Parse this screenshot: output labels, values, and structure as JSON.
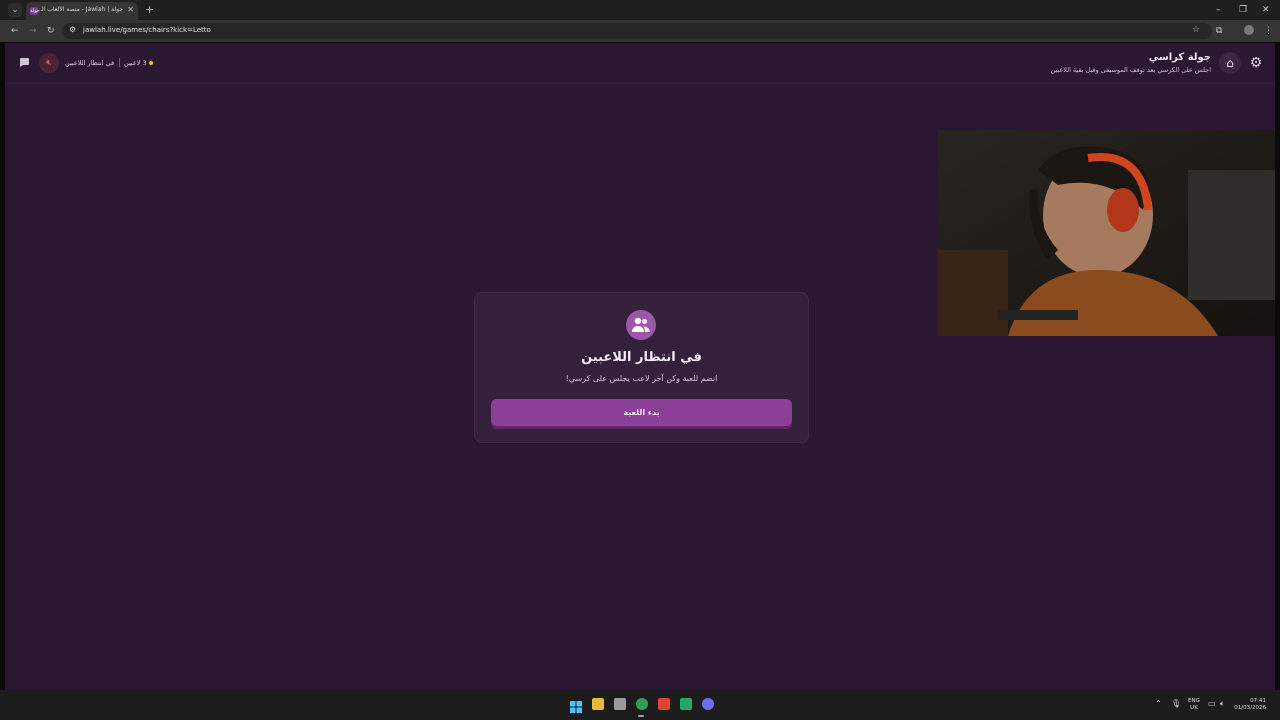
{
  "browser": {
    "tab_title": "جولة | Jawlah - منصة الألعاب الـ",
    "tab_favicon": "جولة",
    "url": "jawlah.live/games/chairs?kick=Letto"
  },
  "header": {
    "title": "جولة كراسي",
    "subtitle": "اجلس على الكرسي بعد توقف الموسيقى وقبل بقية اللاعبين",
    "status_text": "في انتظار اللاعبين",
    "players_count": "3 لاعبين"
  },
  "lobby": {
    "title": "في انتظار اللاعبين",
    "subtitle": "انضم للعبة وكن آخر لاعب يجلس على كرسي!",
    "start_button": "بدء اللعبة"
  },
  "taskbar": {
    "lang_line1": "ENG",
    "lang_line2": "UK",
    "time": "07:41",
    "date": "01/03/2026"
  },
  "colors": {
    "page_background": "#2a1732",
    "card_background": "#33213b",
    "accent": "#8b3f96",
    "icon_circle": "#9c58a8",
    "muted_red": "#e2507a",
    "status_dot": "#f0c419"
  },
  "icons": {
    "settings": "gear-icon",
    "home": "home-icon",
    "chat": "chat-icon",
    "sound": "speaker-muted-icon",
    "lobby": "users-icon"
  }
}
